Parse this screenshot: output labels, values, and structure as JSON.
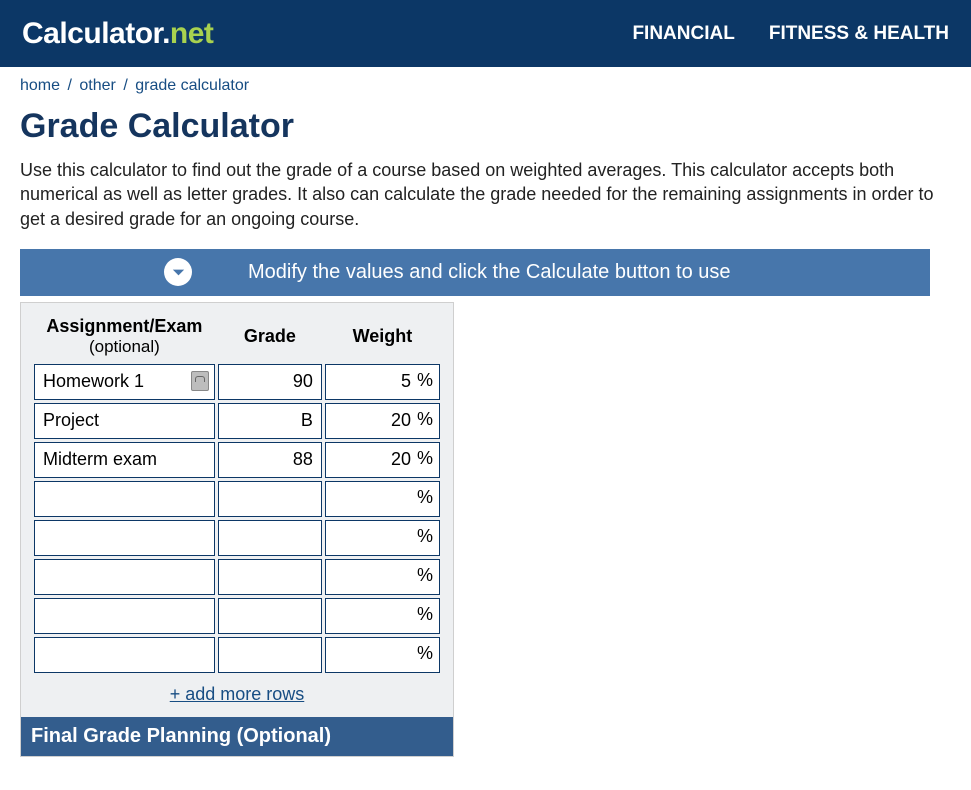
{
  "header": {
    "logo": {
      "left": "Calculator",
      "dot": ".",
      "right": "net"
    },
    "nav": [
      "FINANCIAL",
      "FITNESS & HEALTH"
    ]
  },
  "breadcrumb": {
    "items": [
      "home",
      "other",
      "grade calculator"
    ],
    "sep": "/"
  },
  "title": "Grade Calculator",
  "intro": "Use this calculator to find out the grade of a course based on weighted averages. This calculator accepts both numerical as well as letter grades. It also can calculate the grade needed for the remaining assignments in order to get a desired grade for an ongoing course.",
  "instruction": "Modify the values and click the Calculate button to use",
  "table": {
    "headers": {
      "assignment": "Assignment/Exam",
      "assignment_optional": "(optional)",
      "grade": "Grade",
      "weight": "Weight"
    },
    "rows": [
      {
        "name": "Homework 1",
        "grade": "90",
        "weight": "5"
      },
      {
        "name": "Project",
        "grade": "B",
        "weight": "20"
      },
      {
        "name": "Midterm exam",
        "grade": "88",
        "weight": "20"
      },
      {
        "name": "",
        "grade": "",
        "weight": ""
      },
      {
        "name": "",
        "grade": "",
        "weight": ""
      },
      {
        "name": "",
        "grade": "",
        "weight": ""
      },
      {
        "name": "",
        "grade": "",
        "weight": ""
      },
      {
        "name": "",
        "grade": "",
        "weight": ""
      }
    ],
    "percent_sign": "%",
    "add_more": "+ add more rows"
  },
  "final_planning": "Final Grade Planning (Optional)"
}
